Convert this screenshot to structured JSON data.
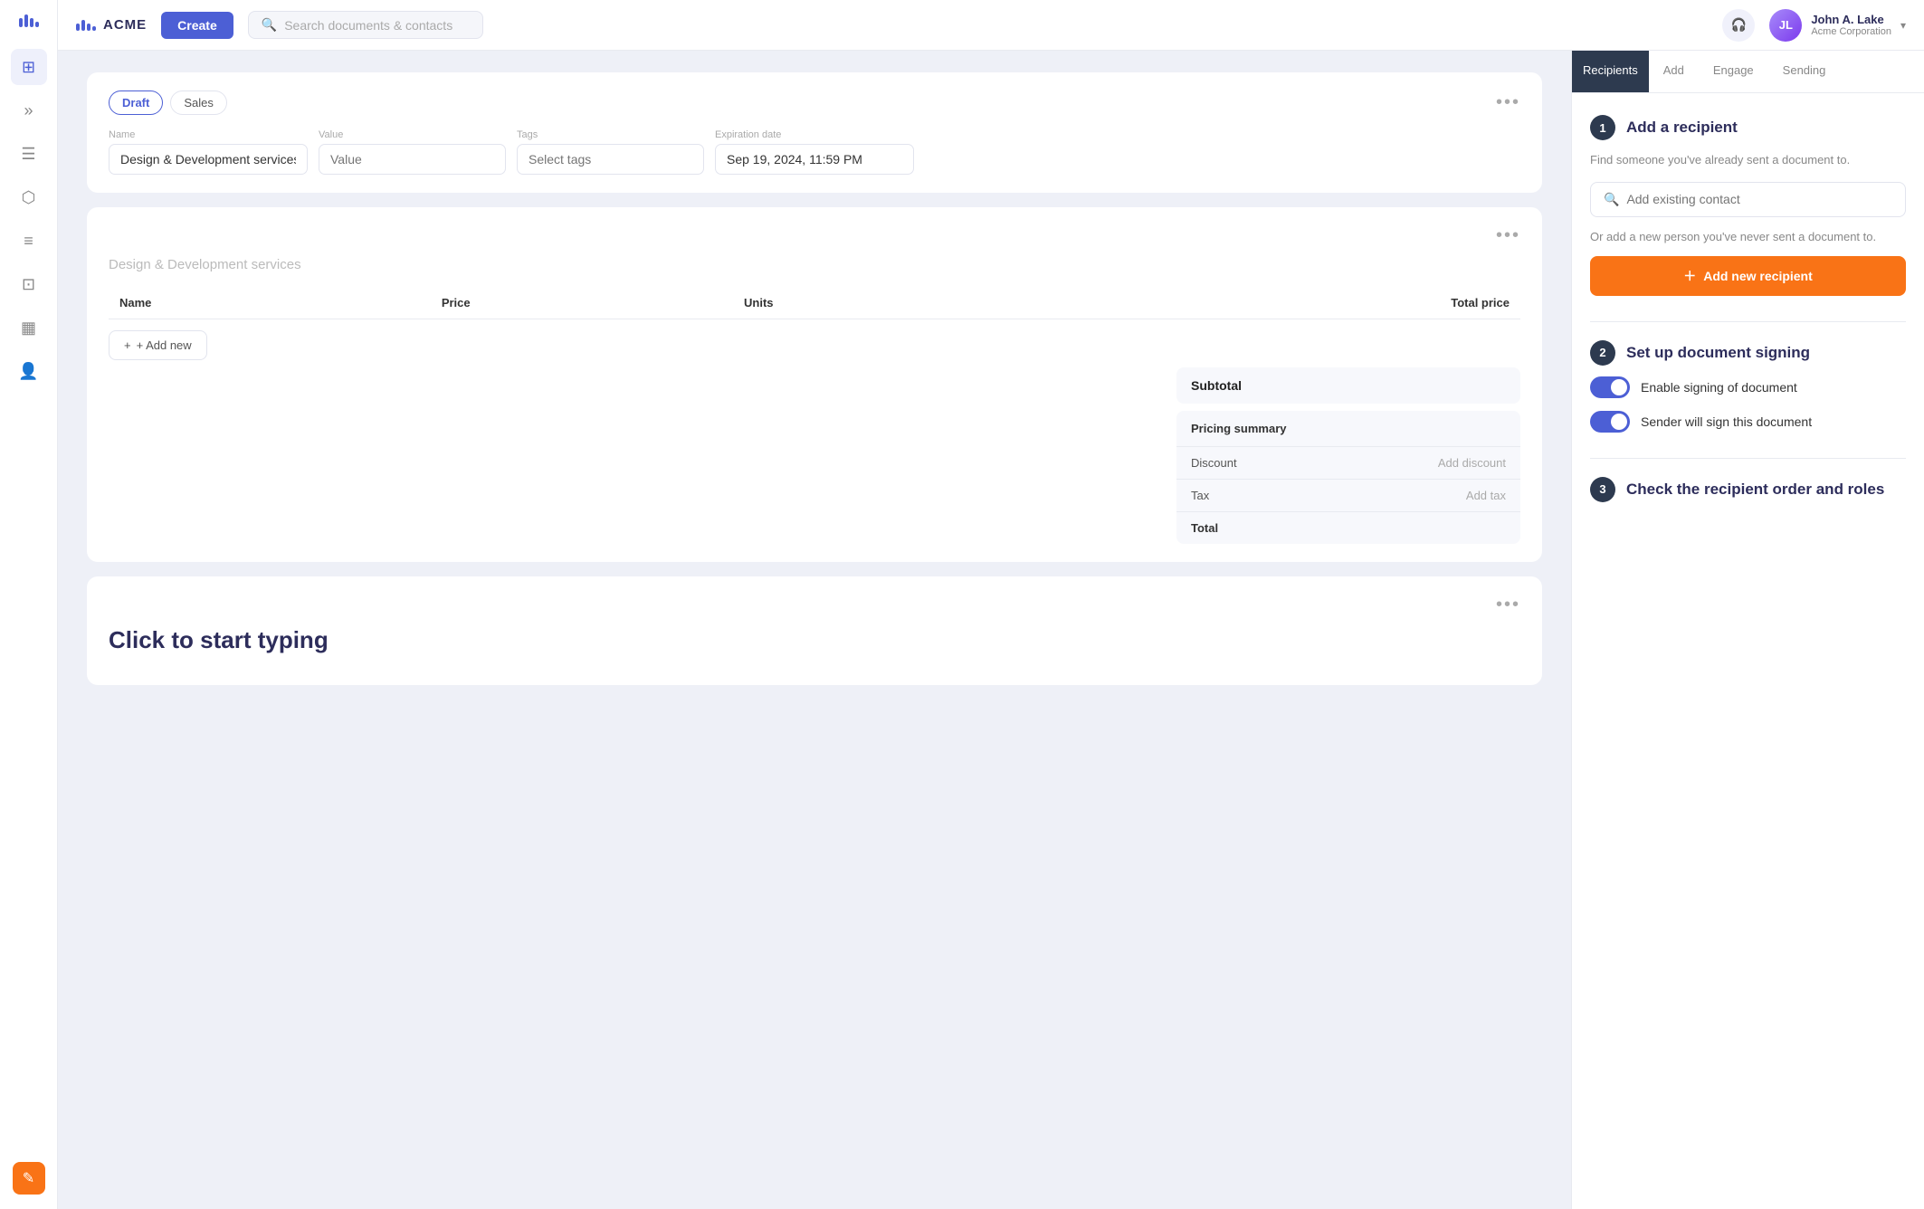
{
  "app": {
    "brand": "ACME",
    "create_label": "Create",
    "search_placeholder": "Search documents & contacts"
  },
  "user": {
    "name": "John A. Lake",
    "org": "Acme Corporation",
    "initials": "JL"
  },
  "sidebar": {
    "items": [
      {
        "id": "dashboard",
        "icon": "⊞"
      },
      {
        "id": "chevrons",
        "icon": "»"
      },
      {
        "id": "document",
        "icon": "☰"
      },
      {
        "id": "cube",
        "icon": "⬡"
      },
      {
        "id": "layers",
        "icon": "≡"
      },
      {
        "id": "inbox",
        "icon": "⊡"
      },
      {
        "id": "chart",
        "icon": "▦"
      },
      {
        "id": "contacts",
        "icon": "👤"
      }
    ],
    "bottom": {
      "icon": "✎"
    }
  },
  "doc": {
    "tabs": [
      {
        "label": "Draft",
        "active": true
      },
      {
        "label": "Sales",
        "active": false
      }
    ],
    "fields": {
      "name_label": "Name",
      "name_value": "Design & Development services",
      "value_label": "Value",
      "value_placeholder": "Value",
      "tags_label": "Tags",
      "tags_placeholder": "Select tags",
      "expiry_label": "Expiration date",
      "expiry_value": "Sep 19, 2024, 11:59 PM"
    },
    "section_title": "Design & Development services",
    "table": {
      "columns": [
        "Name",
        "Price",
        "Units",
        "Total price"
      ],
      "rows": []
    },
    "add_new_label": "+ Add new",
    "subtotal_label": "Subtotal",
    "pricing_summary": {
      "title": "Pricing summary",
      "rows": [
        {
          "label": "Discount",
          "value": "Add discount"
        },
        {
          "label": "Tax",
          "value": "Add tax"
        },
        {
          "label": "Total",
          "value": ""
        }
      ]
    },
    "typing_placeholder": "Click to start typing"
  },
  "panel": {
    "tabs": [
      "Recipients",
      "Add",
      "Engage",
      "Sending"
    ],
    "active_tab": "Recipients",
    "steps": [
      {
        "number": "1",
        "title": "Add a recipient",
        "desc": "Find someone you've already sent a document to.",
        "search_placeholder": "Add existing contact",
        "or_text": "Or add a new person you've never sent a document to.",
        "add_btn_label": "Add new recipient"
      },
      {
        "number": "2",
        "title": "Set up document signing",
        "toggles": [
          {
            "label": "Enable signing of document",
            "checked": true
          },
          {
            "label": "Sender will sign this document",
            "checked": true
          }
        ]
      },
      {
        "number": "3",
        "title": "Check the recipient order and roles"
      }
    ]
  }
}
